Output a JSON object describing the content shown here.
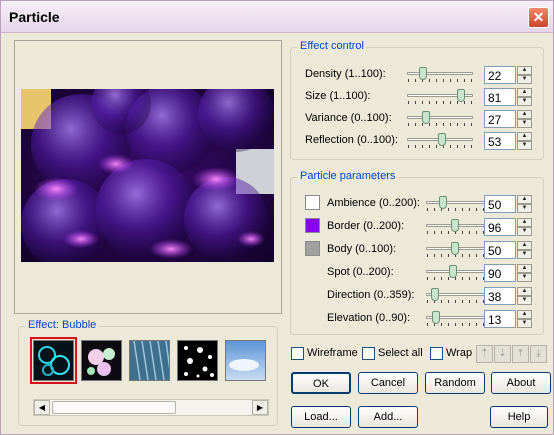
{
  "window": {
    "title": "Particle"
  },
  "effect_control": {
    "legend": "Effect control",
    "rows": [
      {
        "label": "Density (1..100):",
        "value": "22"
      },
      {
        "label": "Size (1..100):",
        "value": "81"
      },
      {
        "label": "Variance (0..100):",
        "value": "27"
      },
      {
        "label": "Reflection (0..100):",
        "value": "53"
      }
    ]
  },
  "particle_parameters": {
    "legend": "Particle parameters",
    "rows": [
      {
        "label": "Ambience (0..200):",
        "value": "50",
        "swatch": "#ffffff"
      },
      {
        "label": "Border (0..200):",
        "value": "96",
        "swatch": "#8800ee"
      },
      {
        "label": "Body (0..100):",
        "value": "50",
        "swatch": "#a0a0a0"
      },
      {
        "label": "Spot (0..200):",
        "value": "90"
      },
      {
        "label": "Direction (0..359):",
        "value": "38"
      },
      {
        "label": "Elevation (0..90):",
        "value": "13"
      }
    ]
  },
  "effect_gallery": {
    "legend": "Effect: Bubble",
    "thumbnails": [
      "bubble",
      "glow",
      "rain",
      "snow",
      "sky"
    ]
  },
  "options": {
    "wireframe": "Wireframe",
    "select_all": "Select all",
    "wrap": "Wrap"
  },
  "buttons": {
    "ok": "OK",
    "cancel": "Cancel",
    "random": "Random",
    "about": "About",
    "load": "Load...",
    "add": "Add...",
    "help": "Help"
  },
  "icons": {
    "close": "close-icon",
    "spin_up": "spin-up-icon",
    "spin_down": "spin-down-icon",
    "move_up": "arrow-up-icon",
    "move_down": "arrow-down-icon",
    "move_top": "arrow-top-icon",
    "move_bottom": "arrow-bottom-icon",
    "scroll_left": "scroll-left-icon",
    "scroll_right": "scroll-right-icon"
  },
  "colors": {
    "legend_text": "#0046d5",
    "selection_border": "#d8111a"
  }
}
